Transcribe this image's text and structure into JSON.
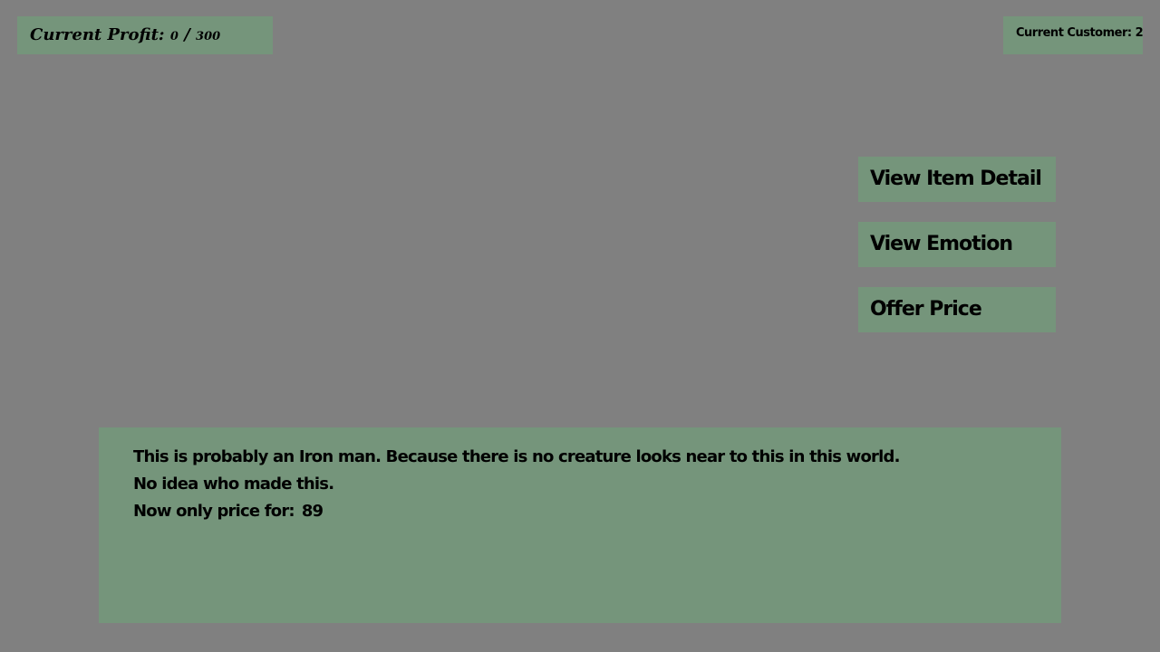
{
  "hud": {
    "profit_label": "Current Profit:",
    "profit_current": "0",
    "profit_sep": "/",
    "profit_target": "300",
    "customer_label": "Current Customer:",
    "customer_number": "2"
  },
  "actions": {
    "view_item_detail": "View Item Detail",
    "view_emotion": "View Emotion",
    "offer_price": "Offer Price"
  },
  "dialog": {
    "line1": "This is probably an Iron man. Because there is no creature looks near to this in this world.",
    "line2": "No idea who made this.",
    "price_label": "Now only price for:",
    "price_value": "89"
  },
  "colors": {
    "background": "#808080",
    "panel": "#75957b",
    "text": "#000000"
  }
}
